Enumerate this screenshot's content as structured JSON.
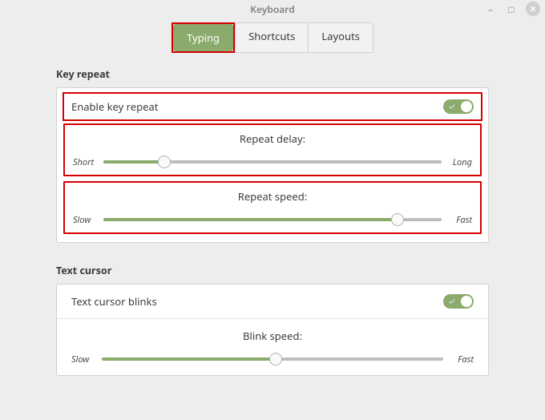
{
  "window": {
    "title": "Keyboard"
  },
  "tabs": {
    "typing": "Typing",
    "shortcuts": "Shortcuts",
    "layouts": "Layouts",
    "active": "typing"
  },
  "key_repeat": {
    "section": "Key repeat",
    "enable_label": "Enable key repeat",
    "enable_on": true,
    "delay": {
      "title": "Repeat delay:",
      "lo": "Short",
      "hi": "Long",
      "pct": 18
    },
    "speed": {
      "title": "Repeat speed:",
      "lo": "Slow",
      "hi": "Fast",
      "pct": 87
    }
  },
  "cursor": {
    "section": "Text cursor",
    "blinks_label": "Text cursor blinks",
    "blinks_on": true,
    "speed": {
      "title": "Blink speed:",
      "lo": "Slow",
      "hi": "Fast",
      "pct": 51
    }
  }
}
